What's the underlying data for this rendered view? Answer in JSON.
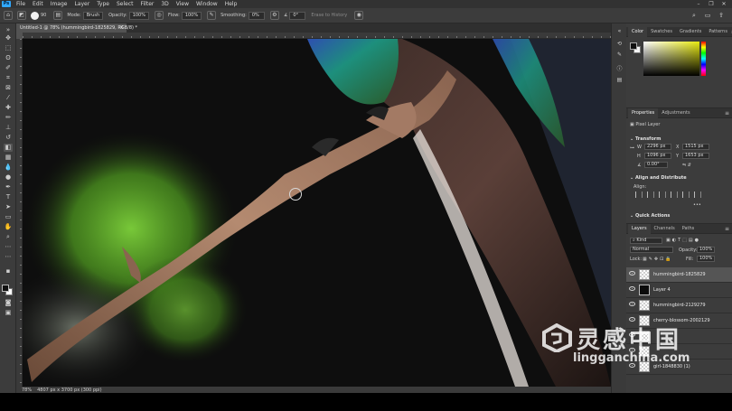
{
  "menu": {
    "logo": "Ps",
    "items": [
      "File",
      "Edit",
      "Image",
      "Layer",
      "Type",
      "Select",
      "Filter",
      "3D",
      "View",
      "Window",
      "Help"
    ]
  },
  "window_controls": {
    "minimize": "–",
    "maximize": "❐",
    "close": "✕"
  },
  "options_bar": {
    "brush_size": "90",
    "mode_label": "Mode:",
    "mode_value": "Brush",
    "opacity_label": "Opacity:",
    "opacity_value": "100%",
    "flow_label": "Flow:",
    "flow_value": "100%",
    "smoothing_label": "Smoothing:",
    "smoothing_value": "0%",
    "angle_value": "0°",
    "erase_history_label": "Erase to History"
  },
  "document_tab": {
    "title": "Untitled-1 @ 78% (hummingbird-1825829, RGB/8) *",
    "close": "×"
  },
  "status_bar": {
    "zoom": "78%",
    "doc_info": "4807 px x 3700 px (300 ppi)"
  },
  "color_panel": {
    "tabs": [
      "Color",
      "Swatches",
      "Gradients",
      "Patterns"
    ],
    "foreground": "#101010",
    "background": "#f4f4f4"
  },
  "properties_panel": {
    "tabs": [
      "Properties",
      "Adjustments"
    ],
    "layer_kind": "Pixel Layer",
    "transform_label": "Transform",
    "w_label": "W",
    "w_value": "2296 px",
    "h_label": "H",
    "h_value": "1096 px",
    "x_label": "X",
    "x_value": "1515 px",
    "y_label": "Y",
    "y_value": "1653 px",
    "angle_value": "0.00°",
    "align_label": "Align and Distribute",
    "align_sub": "Align:",
    "more": "•••",
    "quick_actions_label": "Quick Actions"
  },
  "layers_panel": {
    "tabs": [
      "Layers",
      "Channels",
      "Paths"
    ],
    "kind_label": "Kind",
    "blend_mode": "Normal",
    "opacity_label": "Opacity:",
    "opacity_value": "100%",
    "lock_label": "Lock:",
    "fill_label": "Fill:",
    "fill_value": "100%",
    "layers": [
      {
        "name": "hummingbird-1825829",
        "thumb": "checker",
        "selected": true
      },
      {
        "name": "Layer 4",
        "thumb": "dark",
        "selected": false
      },
      {
        "name": "hummingbird-2129279",
        "thumb": "checker",
        "selected": false
      },
      {
        "name": "cherry-blossom-2002129",
        "thumb": "checker",
        "selected": false
      },
      {
        "name": "",
        "thumb": "checker",
        "selected": false
      },
      {
        "name": "",
        "thumb": "checker",
        "selected": false
      },
      {
        "name": "girl-1848830 (1)",
        "thumb": "checker",
        "selected": false
      }
    ]
  },
  "watermark": {
    "chinese": "灵感中国",
    "url": "lingganchina.com"
  },
  "colors": {
    "accent": "#31a8ff",
    "app_bg": "#535353",
    "panel_bg": "#3c3c3c"
  }
}
